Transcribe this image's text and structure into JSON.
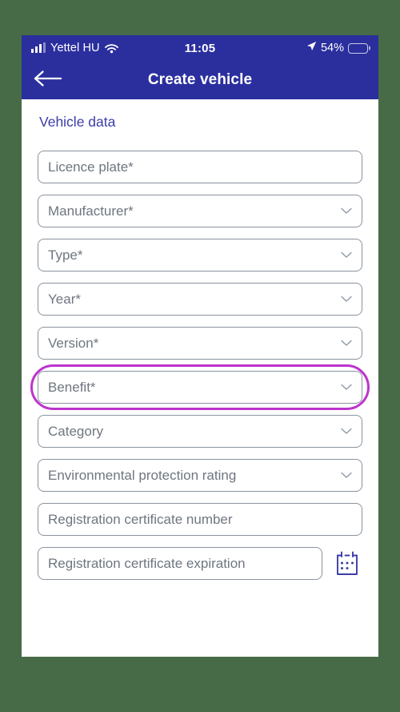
{
  "status_bar": {
    "carrier": "Yettel HU",
    "time": "11:05",
    "battery_percent": "54%",
    "battery_level": 54,
    "signal_icon": "signal-bars-icon",
    "wifi_icon": "wifi-icon",
    "location_icon": "location-arrow-icon",
    "battery_icon": "battery-icon"
  },
  "nav": {
    "title": "Create vehicle",
    "back_icon": "back-arrow-icon"
  },
  "content": {
    "section_title": "Vehicle data",
    "fields": [
      {
        "label": "Licence plate*",
        "type": "text",
        "name": "licence-plate-field",
        "dropdown": false,
        "highlighted": false
      },
      {
        "label": "Manufacturer*",
        "type": "select",
        "name": "manufacturer-field",
        "dropdown": true,
        "highlighted": false
      },
      {
        "label": "Type*",
        "type": "select",
        "name": "type-field",
        "dropdown": true,
        "highlighted": false
      },
      {
        "label": "Year*",
        "type": "select",
        "name": "year-field",
        "dropdown": true,
        "highlighted": false
      },
      {
        "label": "Version*",
        "type": "select",
        "name": "version-field",
        "dropdown": true,
        "highlighted": false
      },
      {
        "label": "Benefit*",
        "type": "select",
        "name": "benefit-field",
        "dropdown": true,
        "highlighted": true
      },
      {
        "label": "Category",
        "type": "select",
        "name": "category-field",
        "dropdown": true,
        "highlighted": false
      },
      {
        "label": "Environmental protection rating",
        "type": "select",
        "name": "environmental-protection-rating-field",
        "dropdown": true,
        "highlighted": false
      },
      {
        "label": "Registration certificate number",
        "type": "text",
        "name": "registration-certificate-number-field",
        "dropdown": false,
        "highlighted": false
      },
      {
        "label": "Registration certificate expiration",
        "type": "date",
        "name": "registration-certificate-expiration-field",
        "dropdown": false,
        "highlighted": false
      }
    ],
    "calendar_icon": "calendar-icon"
  },
  "colors": {
    "header_blue": "#2b2f9e",
    "section_title": "#3c3ca8",
    "highlight_ring": "#bd34cd",
    "field_border": "#8a939e",
    "placeholder_text": "#6f7680",
    "page_background": "#476b46"
  }
}
